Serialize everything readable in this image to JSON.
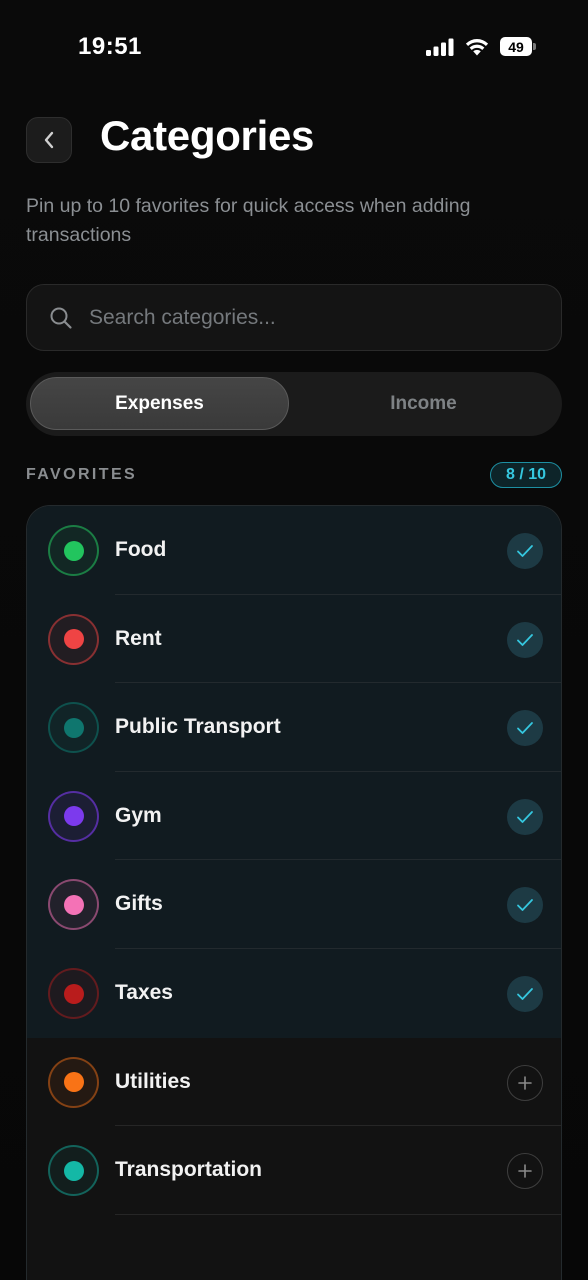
{
  "status_bar": {
    "time": "19:51",
    "battery": "49",
    "icons": [
      "signal-icon",
      "wifi-icon",
      "battery-icon"
    ]
  },
  "header": {
    "back_icon": "chevron-left-icon",
    "title": "Categories",
    "subtitle": "Pin up to 10 favorites for quick access when adding transactions"
  },
  "search": {
    "placeholder": "Search categories...",
    "value": "",
    "icon": "search-icon"
  },
  "tabs": [
    {
      "label": "Expenses",
      "active": true
    },
    {
      "label": "Income",
      "active": false
    }
  ],
  "favorites": {
    "section_label": "FAVORITES",
    "count": "8 / 10"
  },
  "categories": [
    {
      "name": "Food",
      "color": "#22c55e",
      "favorite": true
    },
    {
      "name": "Rent",
      "color": "#ef4444",
      "favorite": true
    },
    {
      "name": "Public Transport",
      "color": "#0f766e",
      "favorite": true
    },
    {
      "name": "Gym",
      "color": "#7c3aed",
      "favorite": true
    },
    {
      "name": "Gifts",
      "color": "#f472b6",
      "favorite": true
    },
    {
      "name": "Taxes",
      "color": "#b91c1c",
      "favorite": true
    },
    {
      "name": "Utilities",
      "color": "#f97316",
      "favorite": false
    },
    {
      "name": "Transportation",
      "color": "#14b8a6",
      "favorite": false
    }
  ],
  "colors": {
    "accent": "#35c7df",
    "background": "#0a0a0a"
  }
}
